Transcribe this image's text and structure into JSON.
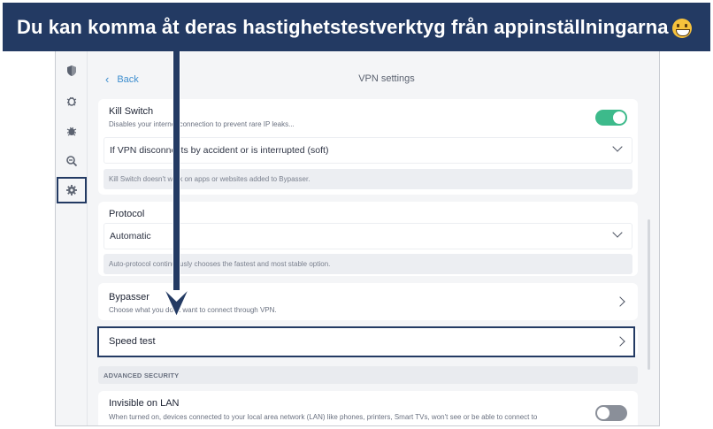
{
  "banner": {
    "text": "Du kan komma åt deras hastighetstestverktyg från appinställningarna",
    "emoji_icon": "grinning-face-icon"
  },
  "sidebar": {
    "items": [
      {
        "icon": "shield-icon"
      },
      {
        "icon": "bug-alert-icon"
      },
      {
        "icon": "bug-icon"
      },
      {
        "icon": "search-minus-icon"
      },
      {
        "icon": "gear-icon",
        "active": true
      }
    ]
  },
  "header": {
    "back_label": "Back",
    "title": "VPN settings"
  },
  "kill_switch": {
    "title": "Kill Switch",
    "subtitle": "Disables your internet connection to prevent rare IP leaks...",
    "toggle_on": true,
    "dropdown_value": "If VPN disconnects by accident or is interrupted (soft)",
    "note": "Kill Switch doesn't work on apps or websites added to Bypasser."
  },
  "protocol": {
    "title": "Protocol",
    "dropdown_value": "Automatic",
    "note": "Auto-protocol continuously chooses the fastest and most stable option."
  },
  "bypasser": {
    "title": "Bypasser",
    "subtitle": "Choose what you don't want to connect through VPN."
  },
  "speed_test": {
    "title": "Speed test"
  },
  "advanced_security": {
    "header": "ADVANCED SECURITY"
  },
  "invisible_lan": {
    "title": "Invisible on LAN",
    "subtitle": "When turned on, devices connected to your local area network (LAN) like phones, printers, Smart TVs, won't see or be able to connect to",
    "toggle_on": false
  },
  "colors": {
    "accent_navy": "#233a63",
    "link_blue": "#3f8fcf",
    "toggle_green": "#3dba8b"
  }
}
